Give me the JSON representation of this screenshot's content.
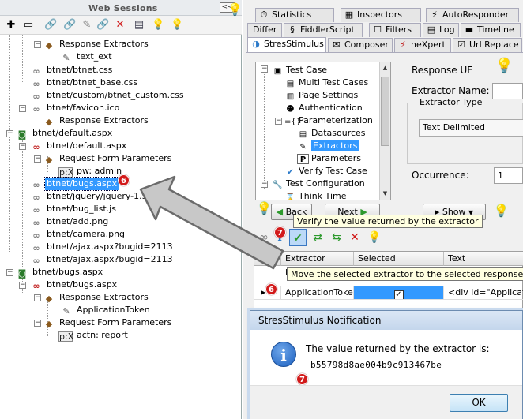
{
  "left_panel": {
    "title": "Web Sessions",
    "collapse_label": "<<",
    "tree": [
      {
        "label": "Response Extractors"
      },
      {
        "label": "text_ext"
      },
      {
        "label": "btnet/btnet.css"
      },
      {
        "label": "btnet/btnet_base.css"
      },
      {
        "label": "btnet/custom/btnet_custom.css"
      },
      {
        "label": "btnet/favicon.ico"
      },
      {
        "label": "Response Extractors"
      },
      {
        "label": "btnet/default.aspx"
      },
      {
        "label": "btnet/default.aspx"
      },
      {
        "label": "Request Form Parameters"
      },
      {
        "label": "pw: admin"
      },
      {
        "label": "btnet/bugs.aspx"
      },
      {
        "label": "btnet/jquery/jquery-1.3"
      },
      {
        "label": "btnet/bug_list.js"
      },
      {
        "label": "btnet/add.png"
      },
      {
        "label": "btnet/camera.png"
      },
      {
        "label": "btnet/ajax.aspx?bugid=2113"
      },
      {
        "label": "btnet/ajax.aspx?bugid=2113"
      },
      {
        "label": "btnet/bugs.aspx"
      },
      {
        "label": "btnet/bugs.aspx"
      },
      {
        "label": "Response Extractors"
      },
      {
        "label": "ApplicationToken"
      },
      {
        "label": "Request Form Parameters"
      },
      {
        "label": "actn: report"
      }
    ],
    "param_tag": "p:X"
  },
  "tabs_row1": [
    "Statistics",
    "Inspectors",
    "AutoResponder"
  ],
  "tabs_row2": [
    "Differ",
    "FiddlerScript",
    "Filters",
    "Log",
    "Timeline"
  ],
  "tabs_row3": [
    "StresStimulus",
    "Composer",
    "neXpert",
    "Url Replace"
  ],
  "process_tree": [
    {
      "label": "Test Case"
    },
    {
      "label": "Multi Test Cases"
    },
    {
      "label": "Page Settings"
    },
    {
      "label": "Authentication"
    },
    {
      "label": "Parameterization"
    },
    {
      "label": "Datasources"
    },
    {
      "label": "Extractors"
    },
    {
      "label": "Parameters"
    },
    {
      "label": "Verify Test Case"
    },
    {
      "label": "Test Configuration"
    },
    {
      "label": "Think Time"
    }
  ],
  "param_prefix": "={}",
  "nav": {
    "back": "Back",
    "next": "Next",
    "show": "Show"
  },
  "form": {
    "response_label": "Response UF",
    "extractor_name_label": "Extractor Name:",
    "extractor_type_label": "Extractor Type",
    "extractor_type_value": "Text Delimited",
    "occurrence_label": "Occurrence:",
    "occurrence_value": "1"
  },
  "tooltips": {
    "verify": "Verify the value returned by the extractor",
    "move": "Move the selected extractor to the selected response"
  },
  "grid": {
    "columns": [
      "Extractor Name",
      "Selected",
      "Text"
    ],
    "row": {
      "name": "ApplicationToken",
      "selected_mark": "✓",
      "text": "<div id=\"Applicat"
    }
  },
  "dialog": {
    "title": "StresStimulus Notification",
    "message": "The value returned by the extractor is:",
    "value": "b55798d8ae004b9c913467be",
    "ok": "OK",
    "info_glyph": "i"
  },
  "badges": {
    "six": "6",
    "seven": "7"
  },
  "colors": {
    "selection": "#3399ff",
    "badge": "#d21a1a",
    "bulb": "#f2c200",
    "arrow_fill": "#c8c8c8"
  }
}
